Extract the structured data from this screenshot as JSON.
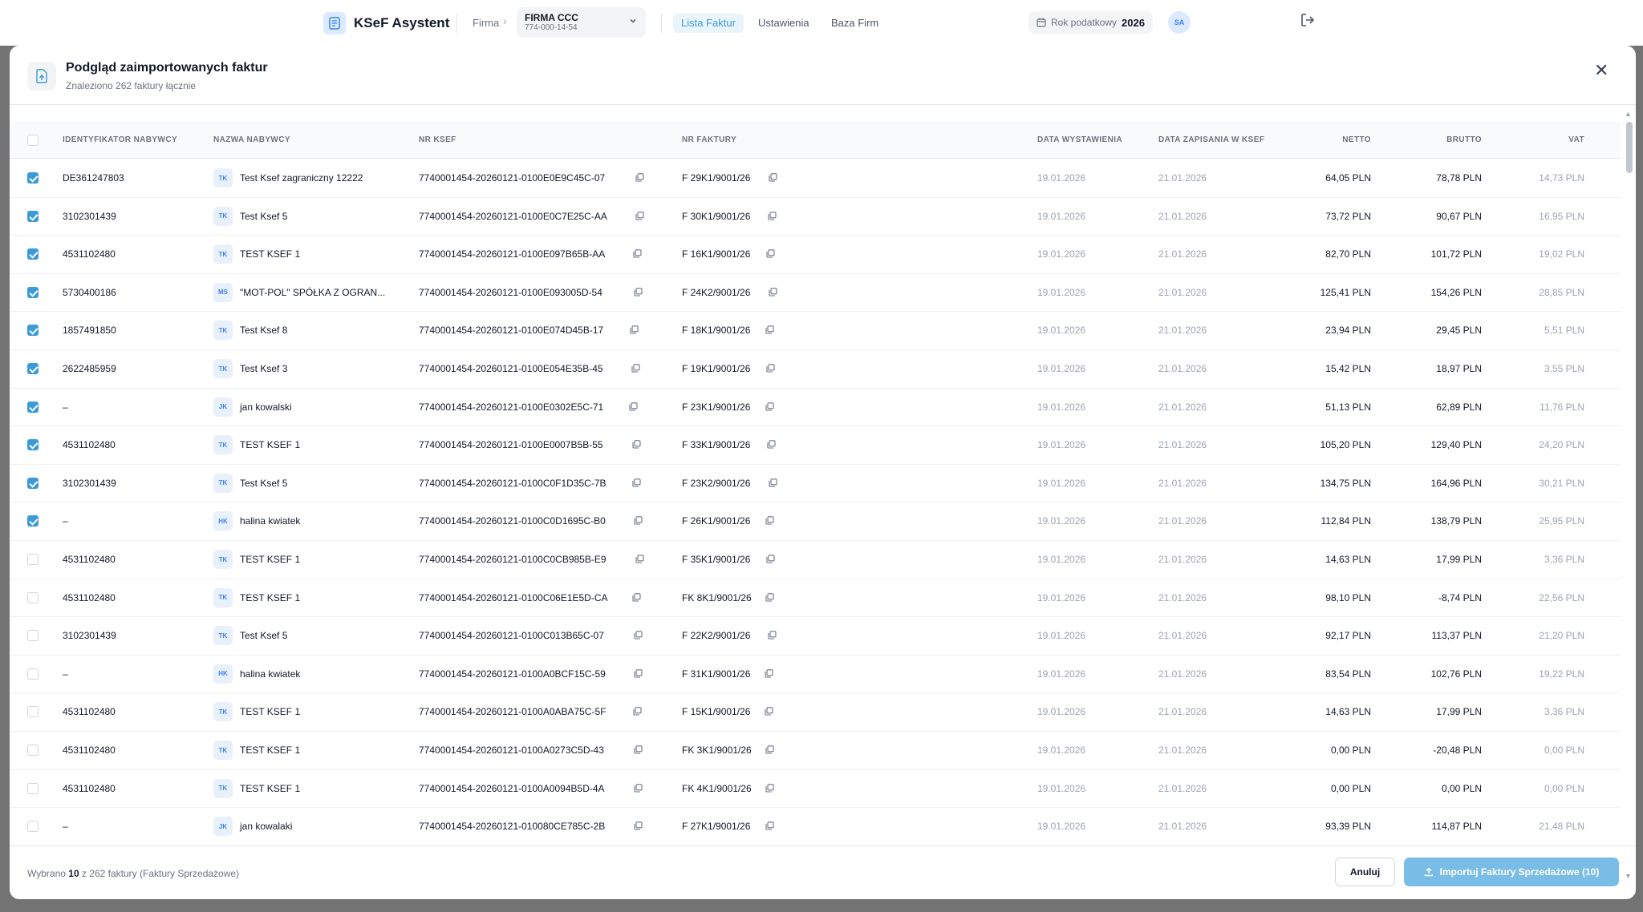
{
  "app": {
    "brand": "KSeF Asystent",
    "firma_label": "Firma",
    "company": {
      "name": "FIRMA CCC",
      "nip": "774-000-14-54"
    },
    "nav": [
      "Lista Faktur",
      "Ustawienia",
      "Baza Firm"
    ],
    "tax_year_label": "Rok podatkowy",
    "tax_year": "2026",
    "avatar": "SA"
  },
  "modal": {
    "title": "Podgląd zaimportowanych faktur",
    "subtitle": "Znaleziono 262 faktury łącznie",
    "columns": {
      "nip": "IDENTYFIKATOR NABYWCY",
      "name": "NAZWA NABYWCY",
      "ksef": "NR KSEF",
      "invoice": "NR FAKTURY",
      "issue": "DATA WYSTAWIENIA",
      "saved": "DATA ZAPISANIA W KSEF",
      "net": "NETTO",
      "gross": "BRUTTO",
      "vat": "VAT"
    },
    "rows": [
      {
        "checked": true,
        "nip": "DE361247803",
        "initials": "TK",
        "name": "Test Ksef zagraniczny 12222",
        "ksef": "7740001454-20260121-0100E0E9C45C-07",
        "invoice": "F 29K1/9001/26",
        "issue": "19.01.2026",
        "saved": "21.01.2026",
        "net": "64,05 PLN",
        "gross": "78,78 PLN",
        "vat": "14,73 PLN"
      },
      {
        "checked": true,
        "nip": "3102301439",
        "initials": "TK",
        "name": "Test Ksef 5",
        "ksef": "7740001454-20260121-0100E0C7E25C-AA",
        "invoice": "F 30K1/9001/26",
        "issue": "19.01.2026",
        "saved": "21.01.2026",
        "net": "73,72 PLN",
        "gross": "90,67 PLN",
        "vat": "16,95 PLN"
      },
      {
        "checked": true,
        "nip": "4531102480",
        "initials": "TK",
        "name": "TEST KSEF 1",
        "ksef": "7740001454-20260121-0100E097B65B-AA",
        "invoice": "F 16K1/9001/26",
        "issue": "19.01.2026",
        "saved": "21.01.2026",
        "net": "82,70 PLN",
        "gross": "101,72 PLN",
        "vat": "19,02 PLN"
      },
      {
        "checked": true,
        "nip": "5730400186",
        "initials": "MS",
        "name": "\"MOT-POL\" SPÓŁKA Z OGRAN...",
        "ksef": "7740001454-20260121-0100E093005D-54",
        "invoice": "F 24K2/9001/26",
        "issue": "19.01.2026",
        "saved": "21.01.2026",
        "net": "125,41 PLN",
        "gross": "154,26 PLN",
        "vat": "28,85 PLN"
      },
      {
        "checked": true,
        "nip": "1857491850",
        "initials": "TK",
        "name": "Test Ksef 8",
        "ksef": "7740001454-20260121-0100E074D45B-17",
        "invoice": "F 18K1/9001/26",
        "issue": "19.01.2026",
        "saved": "21.01.2026",
        "net": "23,94 PLN",
        "gross": "29,45 PLN",
        "vat": "5,51 PLN"
      },
      {
        "checked": true,
        "nip": "2622485959",
        "initials": "TK",
        "name": "Test Ksef 3",
        "ksef": "7740001454-20260121-0100E054E35B-45",
        "invoice": "F 19K1/9001/26",
        "issue": "19.01.2026",
        "saved": "21.01.2026",
        "net": "15,42 PLN",
        "gross": "18,97 PLN",
        "vat": "3,55 PLN"
      },
      {
        "checked": true,
        "nip": "–",
        "initials": "JK",
        "name": "jan kowalski",
        "ksef": "7740001454-20260121-0100E0302E5C-71",
        "invoice": "F 23K1/9001/26",
        "issue": "19.01.2026",
        "saved": "21.01.2026",
        "net": "51,13 PLN",
        "gross": "62,89 PLN",
        "vat": "11,76 PLN"
      },
      {
        "checked": true,
        "nip": "4531102480",
        "initials": "TK",
        "name": "TEST KSEF 1",
        "ksef": "7740001454-20260121-0100E0007B5B-55",
        "invoice": "F 33K1/9001/26",
        "issue": "19.01.2026",
        "saved": "21.01.2026",
        "net": "105,20 PLN",
        "gross": "129,40 PLN",
        "vat": "24,20 PLN"
      },
      {
        "checked": true,
        "nip": "3102301439",
        "initials": "TK",
        "name": "Test Ksef 5",
        "ksef": "7740001454-20260121-0100C0F1D35C-7B",
        "invoice": "F 23K2/9001/26",
        "issue": "19.01.2026",
        "saved": "21.01.2026",
        "net": "134,75 PLN",
        "gross": "164,96 PLN",
        "vat": "30,21 PLN"
      },
      {
        "checked": true,
        "nip": "–",
        "initials": "HK",
        "name": "halina kwiatek",
        "ksef": "7740001454-20260121-0100C0D1695C-B0",
        "invoice": "F 26K1/9001/26",
        "issue": "19.01.2026",
        "saved": "21.01.2026",
        "net": "112,84 PLN",
        "gross": "138,79 PLN",
        "vat": "25,95 PLN"
      },
      {
        "checked": false,
        "nip": "4531102480",
        "initials": "TK",
        "name": "TEST KSEF 1",
        "ksef": "7740001454-20260121-0100C0CB985B-E9",
        "invoice": "F 35K1/9001/26",
        "issue": "19.01.2026",
        "saved": "21.01.2026",
        "net": "14,63 PLN",
        "gross": "17,99 PLN",
        "vat": "3,36 PLN"
      },
      {
        "checked": false,
        "nip": "4531102480",
        "initials": "TK",
        "name": "TEST KSEF 1",
        "ksef": "7740001454-20260121-0100C06E1E5D-CA",
        "invoice": "FK 8K1/9001/26",
        "issue": "19.01.2026",
        "saved": "21.01.2026",
        "net": "98,10 PLN",
        "gross": "-8,74 PLN",
        "vat": "22,56 PLN"
      },
      {
        "checked": false,
        "nip": "3102301439",
        "initials": "TK",
        "name": "Test Ksef 5",
        "ksef": "7740001454-20260121-0100C013B65C-07",
        "invoice": "F 22K2/9001/26",
        "issue": "19.01.2026",
        "saved": "21.01.2026",
        "net": "92,17 PLN",
        "gross": "113,37 PLN",
        "vat": "21,20 PLN"
      },
      {
        "checked": false,
        "nip": "–",
        "initials": "HK",
        "name": "halina kwiatek",
        "ksef": "7740001454-20260121-0100A0BCF15C-59",
        "invoice": "F 31K1/9001/26",
        "issue": "19.01.2026",
        "saved": "21.01.2026",
        "net": "83,54 PLN",
        "gross": "102,76 PLN",
        "vat": "19,22 PLN"
      },
      {
        "checked": false,
        "nip": "4531102480",
        "initials": "TK",
        "name": "TEST KSEF 1",
        "ksef": "7740001454-20260121-0100A0ABA75C-5F",
        "invoice": "F 15K1/9001/26",
        "issue": "19.01.2026",
        "saved": "21.01.2026",
        "net": "14,63 PLN",
        "gross": "17,99 PLN",
        "vat": "3,36 PLN"
      },
      {
        "checked": false,
        "nip": "4531102480",
        "initials": "TK",
        "name": "TEST KSEF 1",
        "ksef": "7740001454-20260121-0100A0273C5D-43",
        "invoice": "FK 3K1/9001/26",
        "issue": "19.01.2026",
        "saved": "21.01.2026",
        "net": "0,00 PLN",
        "gross": "-20,48 PLN",
        "vat": "0,00 PLN"
      },
      {
        "checked": false,
        "nip": "4531102480",
        "initials": "TK",
        "name": "TEST KSEF 1",
        "ksef": "7740001454-20260121-0100A0094B5D-4A",
        "invoice": "FK 4K1/9001/26",
        "issue": "19.01.2026",
        "saved": "21.01.2026",
        "net": "0,00 PLN",
        "gross": "0,00 PLN",
        "vat": "0,00 PLN"
      },
      {
        "checked": false,
        "nip": "–",
        "initials": "JK",
        "name": "jan kowalaki",
        "ksef": "7740001454-20260121-010080CE785C-2B",
        "invoice": "F 27K1/9001/26",
        "issue": "19.01.2026",
        "saved": "21.01.2026",
        "net": "93,39 PLN",
        "gross": "114,87 PLN",
        "vat": "21,48 PLN"
      }
    ],
    "footer": {
      "selected_prefix": "Wybrano",
      "selected_count": "10",
      "selected_suffix": "z 262 faktury (Faktury Sprzedażowe)",
      "cancel": "Anuluj",
      "import": "Importuj Faktury Sprzedażowe (10)"
    }
  },
  "colors": {
    "accent": "#3b9ad8",
    "import_button": "#79bde6",
    "overlay": "#737373"
  },
  "icons": [
    "invoice-icon",
    "chevron-right-icon",
    "chevron-down-icon",
    "calendar-icon",
    "logout-icon",
    "file-import-icon",
    "close-icon",
    "copy-icon",
    "upload-icon"
  ]
}
